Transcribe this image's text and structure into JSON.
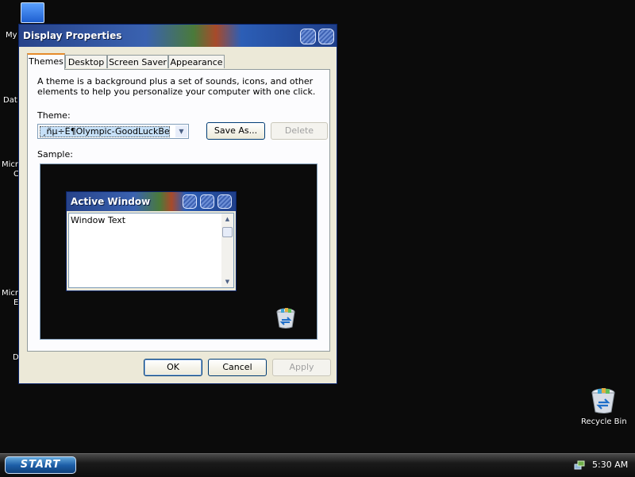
{
  "desktop": {
    "labels": [
      "My",
      "Dat",
      "Micr",
      "C",
      "Micr",
      "E",
      "D"
    ],
    "recycle_bin_label": "Recycle Bin"
  },
  "dialog": {
    "title": "Display Properties",
    "tabs": [
      {
        "label": "Themes"
      },
      {
        "label": "Desktop"
      },
      {
        "label": "Screen Saver"
      },
      {
        "label": "Appearance"
      }
    ],
    "description": "A theme is a background plus a set of sounds, icons, and other elements to help you personalize your computer with one click.",
    "theme_label": "Theme:",
    "theme_value": "¸ñµ÷Ê¶Olympic-GoodLuckBeijing",
    "save_as_label": "Save As...",
    "delete_label": "Delete",
    "sample_label": "Sample:",
    "sample": {
      "window_title": "Active Window",
      "window_text": "Window Text"
    },
    "ok_label": "OK",
    "cancel_label": "Cancel",
    "apply_label": "Apply"
  },
  "taskbar": {
    "start_label": "START",
    "clock": "5:30 AM"
  }
}
